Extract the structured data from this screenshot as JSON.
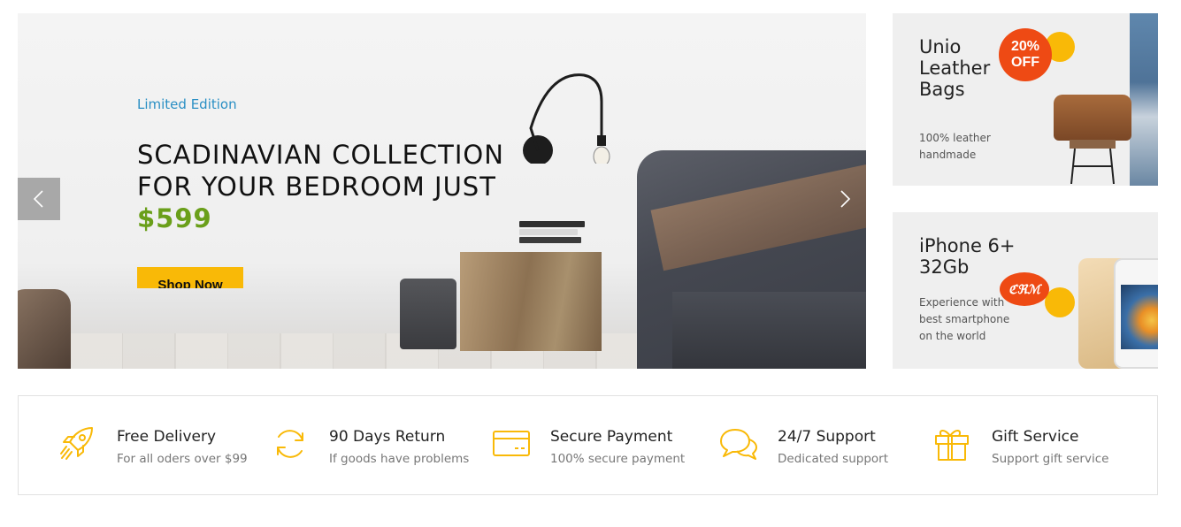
{
  "hero": {
    "eyebrow": "Limited Edition",
    "headline_text": "SCADINAVIAN COLLECTION FOR YOUR BEDROOM JUST ",
    "headline_price": "$599",
    "button_label": "Shop Now",
    "prev_icon": "chevron-left-icon",
    "next_icon": "chevron-right-icon"
  },
  "banners": [
    {
      "title": "Unio\nLeather\nBags",
      "badge": "20%\nOFF",
      "description": "100% leather\nhandmade"
    },
    {
      "title": "iPhone 6+\n32Gb",
      "badge": "ℭℜℳ",
      "description": "Experience with\nbest smartphone\non the world"
    }
  ],
  "services": [
    {
      "icon": "rocket-icon",
      "title": "Free Delivery",
      "subtitle": "For all oders over $99"
    },
    {
      "icon": "refresh-icon",
      "title": "90 Days Return",
      "subtitle": "If goods have problems"
    },
    {
      "icon": "credit-card-icon",
      "title": "Secure Payment",
      "subtitle": "100% secure payment"
    },
    {
      "icon": "chat-bubbles-icon",
      "title": "24/7 Support",
      "subtitle": "Dedicated support"
    },
    {
      "icon": "gift-icon",
      "title": "Gift Service",
      "subtitle": "Support gift service"
    }
  ],
  "colors": {
    "accent_yellow": "#f9b907",
    "price_green": "#6a9f1a",
    "eyebrow_blue": "#2a8fc4",
    "badge_orange": "#ee4a14"
  }
}
